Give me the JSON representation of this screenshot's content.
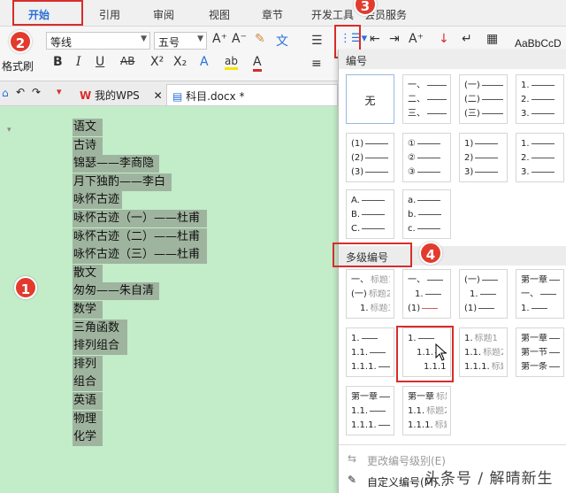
{
  "ribbon": {
    "tabs": [
      "开始",
      "引用",
      "审阅",
      "视图",
      "章节",
      "开发工具",
      "会员服务"
    ]
  },
  "badges": [
    "1",
    "2",
    "3",
    "4"
  ],
  "toolbar": {
    "format_brush": "格式刷",
    "font_name": "等线",
    "font_size": "五号",
    "style_preview": "AaBbCcD",
    "buttons": {
      "bold": "B",
      "italic": "I",
      "underline": "U",
      "strike": "AB",
      "superscript": "X²",
      "subscript": "X₂",
      "grow": "A⁺",
      "shrink": "A⁻",
      "text_effect": "A",
      "highlight": "ab",
      "font_color": "A"
    }
  },
  "doc_tabs": {
    "wps": "我的WPS",
    "file": "科目.docx *"
  },
  "document": {
    "lines": [
      "语文",
      "古诗",
      "锦瑟——李商隐",
      "月下独酌——李白",
      "咏怀古迹",
      "咏怀古迹（一）——杜甫",
      "咏怀古迹（二）——杜甫",
      "咏怀古迹（三）——杜甫",
      "散文",
      "匆匆——朱自清",
      "数学",
      "三角函数",
      "排列组合",
      "排列",
      "组合",
      "英语",
      "物理",
      "化学"
    ]
  },
  "numbering_panel": {
    "header": "编号",
    "none_label": "无",
    "tiles": [
      [
        "一、",
        "二、",
        "三、"
      ],
      [
        "(一)",
        "(二)",
        "(三)"
      ],
      [
        "1.",
        "2.",
        "3."
      ],
      [
        "(1)",
        "(2)",
        "(3)"
      ],
      [
        "①",
        "②",
        "③"
      ],
      [
        "1)",
        "2)",
        "3)"
      ],
      [
        "1.",
        "2.",
        "3."
      ],
      [
        "A.",
        "B.",
        "C."
      ],
      [
        "a.",
        "b.",
        "c."
      ]
    ]
  },
  "multilevel_panel": {
    "header": "多级编号",
    "tiles": [
      [
        {
          "n": "一、",
          "t": "标题1"
        },
        {
          "n": "(一)",
          "t": "标题2"
        },
        {
          "n": "1.",
          "t": "标题3"
        }
      ],
      [
        {
          "n": "一、",
          "t": ""
        },
        {
          "n": "1.",
          "t": ""
        },
        {
          "n": "(1)",
          "t": ""
        }
      ],
      [
        {
          "n": "(一)",
          "t": ""
        },
        {
          "n": "1.",
          "t": ""
        },
        {
          "n": "(1)",
          "t": ""
        }
      ],
      [
        {
          "n": "第一章",
          "t": ""
        },
        {
          "n": "一、",
          "t": ""
        },
        {
          "n": "1.",
          "t": ""
        }
      ],
      [
        {
          "n": "1.",
          "t": ""
        },
        {
          "n": "1.1.",
          "t": ""
        },
        {
          "n": "1.1.1.",
          "t": ""
        }
      ],
      [
        {
          "n": "1.",
          "t": ""
        },
        {
          "n": "1.1.",
          "t": ""
        },
        {
          "n": "1.1.1.",
          "t": ""
        }
      ],
      [
        {
          "n": "1.",
          "t": "标题1"
        },
        {
          "n": "1.1.",
          "t": "标题2"
        },
        {
          "n": "1.1.1.",
          "t": "标题3"
        }
      ],
      [
        {
          "n": "第一章",
          "t": ""
        },
        {
          "n": "第一节",
          "t": ""
        },
        {
          "n": "第一条",
          "t": ""
        }
      ],
      [
        {
          "n": "第一章",
          "t": ""
        },
        {
          "n": "1.1.",
          "t": ""
        },
        {
          "n": "1.1.1.",
          "t": ""
        }
      ],
      [
        {
          "n": "第一章",
          "t": "标题1"
        },
        {
          "n": "1.1.",
          "t": "标题2"
        },
        {
          "n": "1.1.1.",
          "t": "标题3"
        }
      ]
    ]
  },
  "menu": {
    "change_level": "更改编号级别(E)",
    "custom": "自定义编号(M)..."
  },
  "watermark": "头条号 / 解晴新生",
  "colors": {
    "accent": "#2a6fd8",
    "highlight_red": "#d92c2c",
    "badge_red": "#e23b2e",
    "doc_bg": "#c3ecc9",
    "selection": "#9fb49f"
  }
}
